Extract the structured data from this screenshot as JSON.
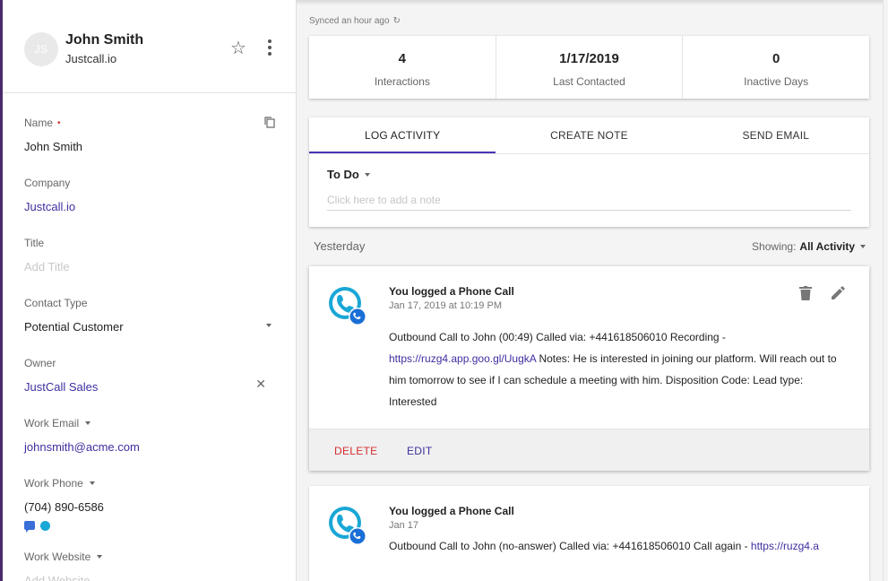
{
  "sync": {
    "text": "Synced an hour ago"
  },
  "contact": {
    "initials": "JS",
    "name": "John Smith",
    "company": "Justcall.io"
  },
  "fields": {
    "name": {
      "label": "Name",
      "value": "John Smith"
    },
    "company": {
      "label": "Company",
      "value": "Justcall.io"
    },
    "title": {
      "label": "Title",
      "placeholder": "Add Title"
    },
    "contact_type": {
      "label": "Contact Type",
      "value": "Potential Customer"
    },
    "owner": {
      "label": "Owner",
      "value": "JustCall Sales"
    },
    "work_email": {
      "label": "Work Email",
      "value": "johnsmith@acme.com"
    },
    "work_phone": {
      "label": "Work Phone",
      "value": "(704) 890-6586"
    },
    "work_website": {
      "label": "Work Website",
      "placeholder": "Add Website"
    }
  },
  "stats": [
    {
      "value": "4",
      "label": "Interactions"
    },
    {
      "value": "1/17/2019",
      "label": "Last Contacted"
    },
    {
      "value": "0",
      "label": "Inactive Days"
    }
  ],
  "tabs": [
    "LOG ACTIVITY",
    "CREATE NOTE",
    "SEND EMAIL"
  ],
  "log": {
    "type": "To Do",
    "note_placeholder": "Click here to add a note"
  },
  "feed": {
    "day": "Yesterday",
    "showing_label": "Showing:",
    "showing_value": "All Activity"
  },
  "activities": [
    {
      "title": "You logged a Phone Call",
      "time": "Jan 17, 2019 at 10:19 PM",
      "body_pre": "Outbound Call to John (00:49) Called via: +441618506010 Recording - ",
      "link": "https://ruzg4.app.goo.gl/UugkA",
      "body_post": " Notes: He is interested in joining our platform. Will reach out to him tomorrow to see if I can schedule a meeting with him. Disposition Code: Lead type: Interested",
      "delete_label": "DELETE",
      "edit_label": "EDIT"
    },
    {
      "title": "You logged a Phone Call",
      "time": "Jan 17",
      "body_pre": "Outbound Call to John (no-answer) Called via: +441618506010 Call again - ",
      "link": "https://ruzg4.a"
    }
  ],
  "colors": {
    "accent": "#4736b8",
    "link": "#3d2fa0",
    "danger": "#d32f2f",
    "sidebar_border": "#4a2a6b"
  }
}
